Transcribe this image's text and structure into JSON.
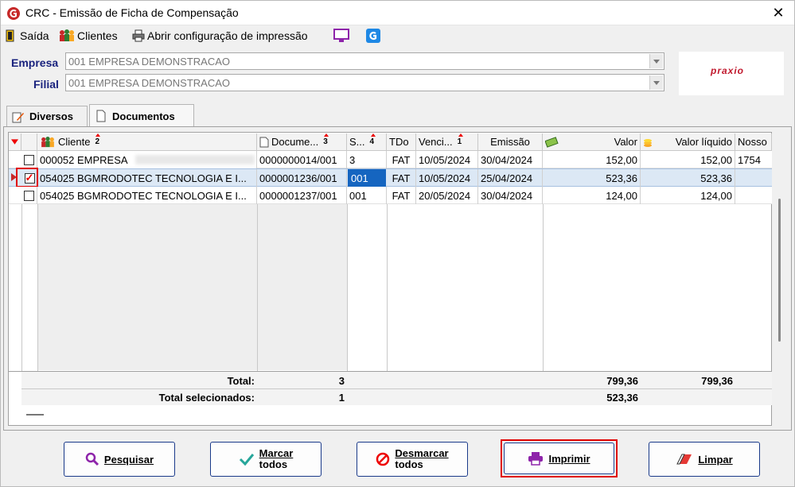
{
  "window": {
    "title": "CRC - Emissão de Ficha de Compensação",
    "close": "✕"
  },
  "toolbar": {
    "saida": "Saída",
    "clientes": "Clientes",
    "config": "Abrir configuração de impressão"
  },
  "form": {
    "empresa_label": "Empresa",
    "empresa_value": "001 EMPRESA DEMONSTRACAO",
    "filial_label": "Filial",
    "filial_value": "001 EMPRESA DEMONSTRACAO",
    "logo_text": "praxio"
  },
  "tabs": {
    "diversos": "Diversos",
    "documentos": "Documentos"
  },
  "grid": {
    "headers": {
      "cliente": "Cliente",
      "cliente_sort": "2",
      "documento": "Docume...",
      "documento_sort": "3",
      "serie": "S...",
      "serie_sort": "4",
      "tdo": "TDo",
      "venc": "Venci...",
      "venc_sort": "1",
      "emissao": "Emissão",
      "valor": "Valor",
      "valor_liquido": "Valor líquido",
      "nosso": "Nosso"
    },
    "rows": [
      {
        "cliente": "000052 EMPRESA",
        "documento": "0000000014/001",
        "serie": "3",
        "tdo": "FAT",
        "venc": "10/05/2024",
        "emissao": "30/04/2024",
        "valor": "152,00",
        "valor_liquido": "152,00",
        "nosso": "1754"
      },
      {
        "cliente": "054025 BGMRODOTEC TECNOLOGIA E I...",
        "documento": "0000001236/001",
        "serie": "001",
        "tdo": "FAT",
        "venc": "10/05/2024",
        "emissao": "25/04/2024",
        "valor": "523,36",
        "valor_liquido": "523,36",
        "nosso": ""
      },
      {
        "cliente": "054025 BGMRODOTEC TECNOLOGIA E I...",
        "documento": "0000001237/001",
        "serie": "001",
        "tdo": "FAT",
        "venc": "20/05/2024",
        "emissao": "30/04/2024",
        "valor": "124,00",
        "valor_liquido": "124,00",
        "nosso": ""
      }
    ],
    "total_label": "Total:",
    "total_count": "3",
    "total_valor": "799,36",
    "total_liquido": "799,36",
    "sel_label": "Total selecionados:",
    "sel_count": "1",
    "sel_valor": "523,36"
  },
  "buttons": {
    "pesquisar": "Pesquisar",
    "marcar_1": "Marcar",
    "marcar_2": "todos",
    "desmarcar_1": "Desmarcar",
    "desmarcar_2": "todos",
    "imprimir": "Imprimir",
    "limpar": "Limpar"
  },
  "colors": {
    "label_blue": "#1a237e",
    "highlight_red": "#e00000",
    "selected_row": "#dce8f5"
  }
}
